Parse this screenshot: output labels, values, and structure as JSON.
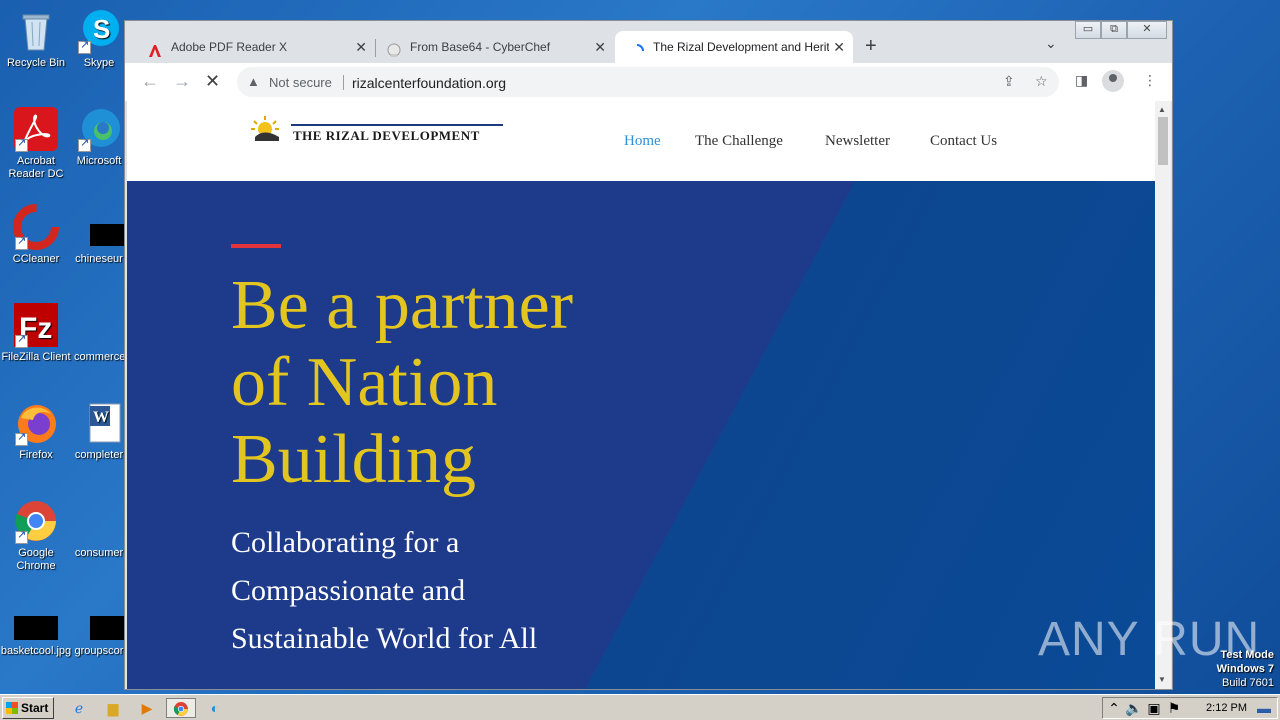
{
  "desktop": {
    "icons": [
      {
        "label": "Recycle Bin"
      },
      {
        "label": "Skype"
      },
      {
        "label": "Acrobat Reader DC"
      },
      {
        "label": "Microsoft"
      },
      {
        "label": "CCleaner"
      },
      {
        "label": "chineseur"
      },
      {
        "label": "FileZilla Client"
      },
      {
        "label": "commerce"
      },
      {
        "label": "Firefox"
      },
      {
        "label": "completer"
      },
      {
        "label": "Google Chrome"
      },
      {
        "label": "consumer"
      },
      {
        "label": "basketcool.jpg"
      },
      {
        "label": "groupscor"
      }
    ]
  },
  "browser": {
    "tabs": [
      {
        "title": "Adobe PDF Reader X",
        "icon": "pdf-icon"
      },
      {
        "title": "From Base64 - CyberChef",
        "icon": "chef-icon"
      },
      {
        "title": "The Rizal Development and Heritage",
        "icon": "loading-spinner-icon"
      }
    ],
    "new_tab": "+",
    "tab_search": "⌄",
    "security_label": "Not secure",
    "url": "rizalcenterfoundation.org",
    "window_controls": {
      "minimize": "▭",
      "maximize": "⧉",
      "close": "✕"
    }
  },
  "site": {
    "logo_text": "THE RIZAL DEVELOPMENT AND",
    "nav": [
      "Home",
      "The Challenge",
      "Newsletter",
      "Contact Us"
    ],
    "active_nav": "Home",
    "headline": [
      "Be a partner",
      "of Nation",
      "Building"
    ],
    "subheadline": [
      "Collaborating for a",
      "Compassionate and",
      "Sustainable World for All"
    ],
    "colors": {
      "hero_bg": "#1e3a8a",
      "headline": "#e3c520",
      "accent_bar": "#e2353b",
      "nav_active": "#2f8fd6"
    }
  },
  "watermark": {
    "brand": "ANY RUN",
    "os_lines": [
      "Test Mode",
      "Windows 7",
      "Build 7601"
    ]
  },
  "taskbar": {
    "start_label": "Start",
    "clock": "2:12 PM"
  }
}
